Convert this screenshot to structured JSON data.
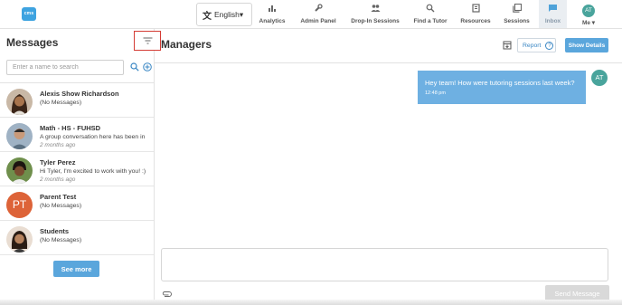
{
  "app": {
    "logo_text": "cms",
    "brand_color": "#3ea3e0",
    "accent_color": "#5aa6dc"
  },
  "topbar": {
    "language": {
      "label": "English",
      "icon": "translate-icon",
      "caret": "▾"
    },
    "nav": [
      {
        "label": "Analytics",
        "icon": "bar-chart-icon"
      },
      {
        "label": "Admin Panel",
        "icon": "wrench-icon"
      },
      {
        "label": "Drop-In Sessions",
        "icon": "people-icon"
      },
      {
        "label": "Find a Tutor",
        "icon": "search-icon"
      },
      {
        "label": "Resources",
        "icon": "book-icon"
      },
      {
        "label": "Sessions",
        "icon": "library-icon"
      },
      {
        "label": "Inbox",
        "icon": "chat-icon",
        "active": true
      },
      {
        "label": "Me",
        "icon": "avatar",
        "avatar_initials": "AT",
        "caret": "▾"
      }
    ]
  },
  "sidebar": {
    "title": "Messages",
    "filter_icon": "filter-icon",
    "search_placeholder": "Enter a name to search",
    "conversations": [
      {
        "name": "Alexis Show Richardson",
        "preview": "(No Messages)",
        "time": ""
      },
      {
        "name": "Math - HS - FUHSD",
        "preview": "A group conversation here has been in",
        "time": "2 months ago"
      },
      {
        "name": "Tyler Perez",
        "preview": "Hi Tyler, I'm excited to work with you! :)",
        "time": "2 months ago"
      },
      {
        "name": "Parent Test",
        "preview": "(No Messages)",
        "time": "",
        "initials": "PT",
        "avatar_color": "#dd6338"
      },
      {
        "name": "Students",
        "preview": "(No Messages)",
        "time": ""
      }
    ],
    "see_more_label": "See more"
  },
  "main": {
    "title": "Managers",
    "report_label": "Report",
    "report_help": "?",
    "show_details_label": "Show Details",
    "messages": [
      {
        "text": "Hey team! How were tutoring sessions last week?",
        "time": "12:48 pm",
        "sender_initials": "AT"
      }
    ],
    "composer_placeholder": "",
    "send_label": "Send Message"
  }
}
